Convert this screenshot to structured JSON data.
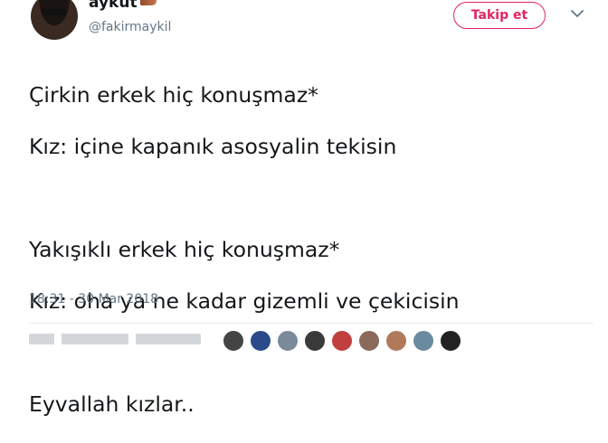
{
  "author": {
    "display_name": "aykut",
    "handle": "@fakirmaykil"
  },
  "follow_button": {
    "label": "Takip et"
  },
  "tweet": {
    "lines": [
      "Çirkin erkek hiç konuşmaz*",
      "Kız: içine kapanık asosyalin tekisin",
      "",
      "Yakışıklı erkek hiç konuşmaz*",
      "Kız: oha ya ne kadar gizemli ve çekicisin",
      "",
      "Eyvallah kızlar.."
    ],
    "timestamp": "18:31 - 30 Mar 2018"
  },
  "colors": {
    "accent": "#e0245e",
    "secondary_text": "#657786",
    "divider": "#e6ecf0"
  },
  "icons": [
    "chevron-down-icon",
    "avatar"
  ],
  "likers": [
    "#444444",
    "#2a4a8a",
    "#7a8a9a",
    "#3a3a3a",
    "#c04040",
    "#8a6a5a",
    "#b07a5a",
    "#6a8aa0",
    "#222222"
  ]
}
